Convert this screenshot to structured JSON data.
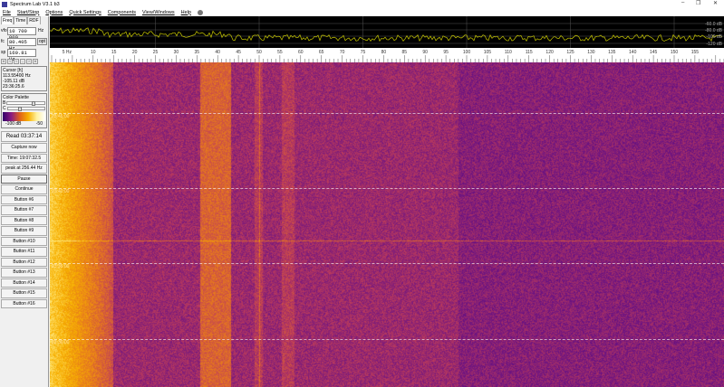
{
  "window": {
    "title": "Spectrum Lab V3.1 b3",
    "min": "–",
    "max": "❐",
    "close": "✕"
  },
  "menu": [
    "File",
    "Start/Stop",
    "Options",
    "Quick Settings",
    "Components",
    "View/Windows",
    "Help"
  ],
  "tabs": [
    "Freq",
    "Time",
    "RDF"
  ],
  "vfo": {
    "label": "vfo",
    "value": "10 700 000",
    "suffix": "Hz"
  },
  "fc": {
    "label": "fc",
    "value": "80.405 Hz",
    "button": "opt"
  },
  "sp": {
    "label": "sp",
    "value": "160.81 Hz"
  },
  "small_buttons": [
    "«",
    "‹",
    "‹",
    "-",
    "›",
    "»"
  ],
  "cursor": {
    "title": "Cursor [h]",
    "freq": "113.55400 Hz",
    "level": "-105.11 dB",
    "time": "23:36:25.6"
  },
  "palette": {
    "title": "Color Palette",
    "b_label": "B",
    "c_label": "C",
    "min": "-100 dB",
    "max": "-50",
    "b_value": 0.72,
    "c_value": 0.3
  },
  "buttons": {
    "read": "Read 03:37:14",
    "capture": "Capture now",
    "time": "Time:  19:07:32.5",
    "peak": "peak at 256.44 Hz",
    "pause": "Pause",
    "continue": "Continue",
    "custom": [
      "Button #6",
      "Button #7",
      "Button #8",
      "Button #9",
      "Button #10",
      "Button #11",
      "Button #12",
      "Button #13",
      "Button #14",
      "Button #15",
      "Button #16"
    ]
  },
  "spectrum": {
    "db_labels": [
      "-60.0 dB",
      "-80.0 dB",
      "-100 dB",
      "-120 dB"
    ],
    "trace_color": "#c8c800"
  },
  "freq_axis": {
    "labels": [
      "5 Hz",
      "10",
      "15",
      "20",
      "25",
      "30",
      "35",
      "40",
      "45",
      "50",
      "55",
      "60",
      "65",
      "70",
      "75",
      "80",
      "85",
      "90",
      "95",
      "100",
      "105",
      "110",
      "115",
      "120",
      "125",
      "130",
      "135",
      "140",
      "145",
      "150",
      "155"
    ],
    "unit_step_hz": 5,
    "max_hz": 162
  },
  "waterfall": {
    "time_labels": [
      "23:45:00",
      "23:40:00",
      "23:35:00",
      "23:30:00"
    ]
  }
}
